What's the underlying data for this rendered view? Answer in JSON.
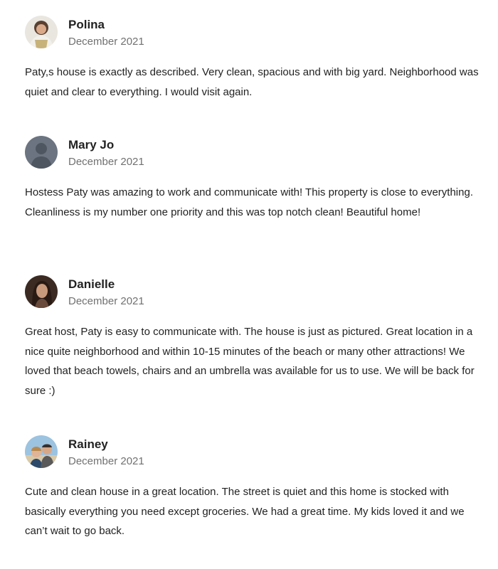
{
  "reviews": [
    {
      "name": "Polina",
      "date": "December 2021",
      "text": "Paty,s house is exactly as described. Very clean, spacious and with big yard. Neighborhood was quiet and clear to everything. I would visit again.",
      "avatar": "user-photo-avatar"
    },
    {
      "name": "Mary Jo",
      "date": "December 2021",
      "text": "Hostess Paty was amazing to work and communicate with! This property is close to everything. Cleanliness is my number one priority and this was top notch clean! Beautiful home!",
      "avatar": "default-user-avatar"
    },
    {
      "name": "Danielle",
      "date": "December 2021",
      "text": "Great host, Paty is easy to communicate with. The house is just as pictured. Great location in a nice quite neighborhood and within 10-15 minutes of the beach or many other attractions! We loved that beach towels, chairs and an umbrella was available for us to use. We will be back for sure :)",
      "avatar": "user-photo-avatar"
    },
    {
      "name": "Rainey",
      "date": "December 2021",
      "text": "Cute and clean house in a great location. The street is quiet and this home is stocked with basically everything you need except groceries. We had a great time. My kids loved it and we can’t wait to go back.",
      "avatar": "user-photo-avatar"
    }
  ]
}
